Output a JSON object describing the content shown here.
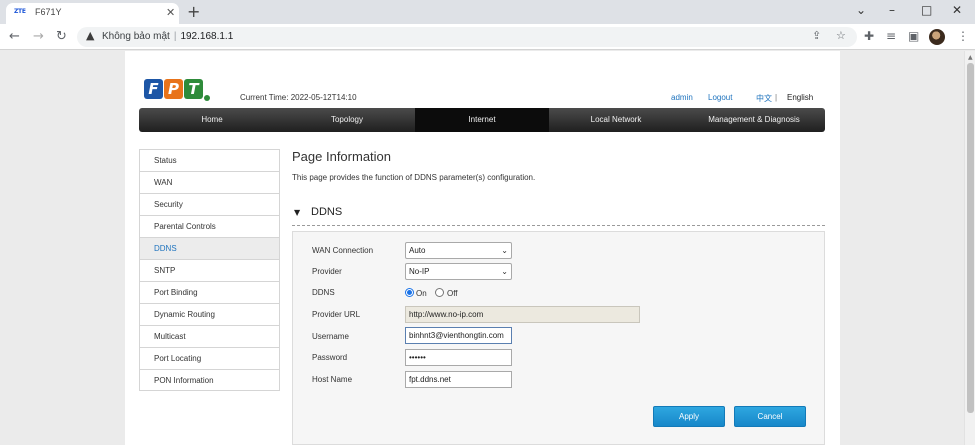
{
  "browser": {
    "tab": {
      "favicon_text": "ZTE",
      "title": "F671Y",
      "close": "✕"
    },
    "new_tab": "+",
    "window_controls": {
      "dropdown": "⌄",
      "minimize": "–",
      "maximize": "□",
      "close": "✕"
    },
    "nav": {
      "back": "←",
      "forward": "→",
      "reload": "↻"
    },
    "address": {
      "security_label": "Không bảo mật",
      "url": "192.168.1.1"
    },
    "toolbar_icons": [
      "share-icon",
      "star-icon",
      "extensions-icon",
      "media-icon",
      "sidepanel-icon",
      "avatar",
      "menu-icon"
    ]
  },
  "router": {
    "brand_letters": [
      "F",
      "P",
      "T"
    ],
    "brand_colors": [
      "#1d56a6",
      "#e8731a",
      "#2e8b3a"
    ],
    "current_time_label": "Current Time:",
    "current_time_value": "2022-05-12T14:10",
    "user": "admin",
    "logout": "Logout",
    "lang_zh": "中文",
    "lang_sep": "|",
    "lang_en": "English",
    "main_nav": [
      {
        "label": "Home",
        "active": false
      },
      {
        "label": "Topology",
        "active": false
      },
      {
        "label": "Internet",
        "active": true
      },
      {
        "label": "Local Network",
        "active": false
      },
      {
        "label": "Management & Diagnosis",
        "active": false
      }
    ],
    "left_menu": [
      {
        "label": "Status",
        "active": false
      },
      {
        "label": "WAN",
        "active": false
      },
      {
        "label": "Security",
        "active": false
      },
      {
        "label": "Parental Controls",
        "active": false
      },
      {
        "label": "DDNS",
        "active": true
      },
      {
        "label": "SNTP",
        "active": false
      },
      {
        "label": "Port Binding",
        "active": false
      },
      {
        "label": "Dynamic Routing",
        "active": false
      },
      {
        "label": "Multicast",
        "active": false
      },
      {
        "label": "Port Locating",
        "active": false
      },
      {
        "label": "PON Information",
        "active": false
      }
    ],
    "page_title": "Page Information",
    "page_desc": "This page provides the function of DDNS parameter(s) configuration.",
    "section_title": "DDNS",
    "form": {
      "wan_connection": {
        "label": "WAN Connection",
        "value": "Auto"
      },
      "provider": {
        "label": "Provider",
        "value": "No-IP"
      },
      "ddns": {
        "label": "DDNS",
        "on_label": "On",
        "off_label": "Off",
        "selected": "On"
      },
      "provider_url": {
        "label": "Provider URL",
        "value": "http://www.no-ip.com"
      },
      "username": {
        "label": "Username",
        "value": "binhnt3@vienthongtin.com"
      },
      "password": {
        "label": "Password",
        "value": "••••••"
      },
      "host_name": {
        "label": "Host Name",
        "value": "fpt.ddns.net"
      }
    },
    "apply": "Apply",
    "cancel": "Cancel"
  },
  "colors": {
    "accent_blue": "#1e73be",
    "button_blue": "#1f97d6",
    "nav_dark": "#2b2b2b"
  }
}
